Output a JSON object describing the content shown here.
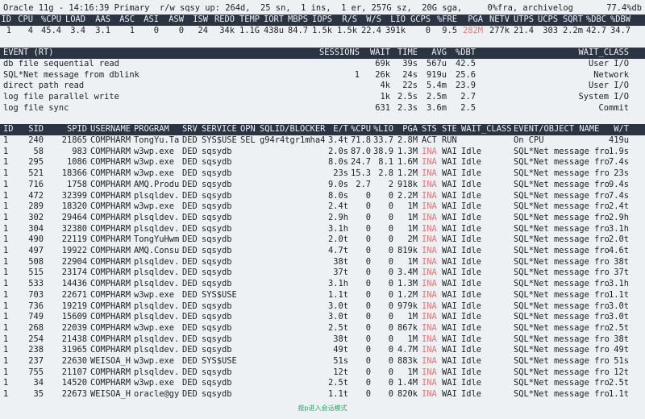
{
  "summary": {
    "title_line_left": "Oracle 11g - 14:16:39 Primary  r/w sqsy up: 264d,  25 sn,  1 ins,  1 er, 257G sz,  20G sga,     0%fra, archivelog",
    "title_line_right": "77.4%db"
  },
  "metrics": {
    "headers": [
      "ID",
      "CPU",
      "%CPU",
      "LOAD",
      "AAS",
      "ASC",
      "ASI",
      "ASW",
      "ISW",
      "REDO",
      "TEMP",
      "IORT",
      "MBPS",
      "IOPS",
      "R/S",
      "W/S",
      "LIO",
      "GCPS",
      "%FRE",
      "PGA",
      "NETV",
      "UTPS",
      "UCPS",
      "SQRT",
      "%DBC",
      "%DBW"
    ],
    "values": [
      "1",
      "4",
      "45.4",
      "3.4",
      "3.1",
      "1",
      "0",
      "0",
      "24",
      "34k",
      "1.1G",
      "438u",
      "84.7",
      "1.5k",
      "1.5k",
      "22.4",
      "391k",
      "0",
      "9.5",
      "282M",
      "277k",
      "21.4",
      "303",
      "2.2m",
      "42.7",
      "34.7"
    ]
  },
  "events": {
    "headers": [
      "EVENT (RT)",
      "SESSIONS",
      "WAIT",
      "TIME",
      "AVG",
      "%DBT",
      "WAIT_CLASS"
    ],
    "rows": [
      [
        "db file sequential read",
        "",
        "69k",
        "39s",
        "567u",
        "42.5",
        "User I/O"
      ],
      [
        "SQL*Net message from dblink",
        "1",
        "26k",
        "24s",
        "919u",
        "25.6",
        "Network"
      ],
      [
        "direct path read",
        "",
        "4k",
        "22s",
        "5.4m",
        "23.9",
        "User I/O"
      ],
      [
        "log file parallel write",
        "",
        "1k",
        "2.5s",
        "2.5m",
        "2.7",
        "System I/O"
      ],
      [
        "log file sync",
        "",
        "631",
        "2.3s",
        "3.6m",
        "2.5",
        "Commit"
      ]
    ]
  },
  "sessions": {
    "headers": [
      "ID",
      "SID",
      "SPID",
      "USERNAME",
      "PROGRAM",
      "SRV",
      "SERVICE",
      "OPN",
      "SQLID/BLOCKER",
      "E/T",
      "%CPU",
      "%LIO",
      "PGA",
      "STS",
      "STE",
      "WAIT_CLASS",
      "EVENT/OBJECT NAME",
      "W/T"
    ],
    "rows": [
      [
        "1",
        "240",
        "21865",
        "COMPHARM",
        "TongYu.Ta",
        "DED",
        "SYS$USE",
        "SEL",
        "g94r4tgr1mha4",
        "3.4t",
        "71.8",
        "33.7",
        "2.8M",
        "ACT",
        "RUN",
        "",
        "On CPU",
        "419u"
      ],
      [
        "1",
        "58",
        "983",
        "COMPHARM",
        "w3wp.exe",
        "DED",
        "sqsydb",
        "",
        "",
        "2.0s",
        "87.0",
        "38.9",
        "1.3M",
        "INA",
        "WAI",
        "Idle",
        "SQL*Net message fro",
        "1.9s"
      ],
      [
        "1",
        "295",
        "1086",
        "COMPHARM",
        "w3wp.exe",
        "DED",
        "sqsydb",
        "",
        "",
        "8.0s",
        "24.7",
        "8.1",
        "1.6M",
        "INA",
        "WAI",
        "Idle",
        "SQL*Net message fro",
        "7.4s"
      ],
      [
        "1",
        "521",
        "18366",
        "COMPHARM",
        "w3wp.exe",
        "DED",
        "sqsydb",
        "",
        "",
        "23s",
        "15.3",
        "2.8",
        "1.2M",
        "INA",
        "WAI",
        "Idle",
        "SQL*Net message fro",
        "23s"
      ],
      [
        "1",
        "716",
        "1758",
        "COMPHARM",
        "AMQ.Produ",
        "DED",
        "sqsydb",
        "",
        "",
        "9.0s",
        "2.7",
        "2",
        "918k",
        "INA",
        "WAI",
        "Idle",
        "SQL*Net message fro",
        "9.4s"
      ],
      [
        "1",
        "472",
        "32399",
        "COMPHARM",
        "plsqldev.",
        "DED",
        "sqsydb",
        "",
        "",
        "8.0s",
        "0",
        "0",
        "2.2M",
        "INA",
        "WAI",
        "Idle",
        "SQL*Net message fro",
        "7.4s"
      ],
      [
        "1",
        "289",
        "18320",
        "COMPHARM",
        "w3wp.exe",
        "DED",
        "sqsydb",
        "",
        "",
        "2.4t",
        "0",
        "0",
        "1M",
        "INA",
        "WAI",
        "Idle",
        "SQL*Net message fro",
        "2.4t"
      ],
      [
        "1",
        "302",
        "29464",
        "COMPHARM",
        "plsqldev.",
        "DED",
        "sqsydb",
        "",
        "",
        "2.9h",
        "0",
        "0",
        "1M",
        "INA",
        "WAI",
        "Idle",
        "SQL*Net message fro",
        "2.9h"
      ],
      [
        "1",
        "304",
        "32380",
        "COMPHARM",
        "plsqldev.",
        "DED",
        "sqsydb",
        "",
        "",
        "3.1h",
        "0",
        "0",
        "1M",
        "INA",
        "WAI",
        "Idle",
        "SQL*Net message fro",
        "3.1h"
      ],
      [
        "1",
        "490",
        "22119",
        "COMPHARM",
        "TongYuHwm",
        "DED",
        "sqsydb",
        "",
        "",
        "2.0t",
        "0",
        "0",
        "2M",
        "INA",
        "WAI",
        "Idle",
        "SQL*Net message fro",
        "2.0t"
      ],
      [
        "1",
        "497",
        "19922",
        "COMPHARM",
        "AMQ.Consu",
        "DED",
        "sqsydb",
        "",
        "",
        "4.7t",
        "0",
        "0",
        "819k",
        "INA",
        "WAI",
        "Idle",
        "SQL*Net message fro",
        "4.6t"
      ],
      [
        "1",
        "508",
        "22904",
        "COMPHARM",
        "plsqldev.",
        "DED",
        "sqsydb",
        "",
        "",
        "38t",
        "0",
        "0",
        "1M",
        "INA",
        "WAI",
        "Idle",
        "SQL*Net message fro",
        "38t"
      ],
      [
        "1",
        "515",
        "23174",
        "COMPHARM",
        "plsqldev.",
        "DED",
        "sqsydb",
        "",
        "",
        "37t",
        "0",
        "0",
        "3.4M",
        "INA",
        "WAI",
        "Idle",
        "SQL*Net message fro",
        "37t"
      ],
      [
        "1",
        "533",
        "14436",
        "COMPHARM",
        "plsqldev.",
        "DED",
        "sqsydb",
        "",
        "",
        "3.1h",
        "0",
        "0",
        "1.3M",
        "INA",
        "WAI",
        "Idle",
        "SQL*Net message fro",
        "3.1h"
      ],
      [
        "1",
        "703",
        "22671",
        "COMPHARM",
        "w3wp.exe",
        "DED",
        "SYS$USE",
        "",
        "",
        "1.1t",
        "0",
        "0",
        "1.2M",
        "INA",
        "WAI",
        "Idle",
        "SQL*Net message fro",
        "1.1t"
      ],
      [
        "1",
        "736",
        "19219",
        "COMPHARM",
        "plsqldev.",
        "DED",
        "sqsydb",
        "",
        "",
        "3.0t",
        "0",
        "0",
        "979k",
        "INA",
        "WAI",
        "Idle",
        "SQL*Net message fro",
        "3.0t"
      ],
      [
        "1",
        "749",
        "15609",
        "COMPHARM",
        "plsqldev.",
        "DED",
        "sqsydb",
        "",
        "",
        "3.0t",
        "0",
        "0",
        "1M",
        "INA",
        "WAI",
        "Idle",
        "SQL*Net message fro",
        "3.0t"
      ],
      [
        "1",
        "268",
        "22039",
        "COMPHARM",
        "w3wp.exe",
        "DED",
        "sqsydb",
        "",
        "",
        "2.5t",
        "0",
        "0",
        "867k",
        "INA",
        "WAI",
        "Idle",
        "SQL*Net message fro",
        "2.5t"
      ],
      [
        "1",
        "254",
        "21438",
        "COMPHARM",
        "plsqldev.",
        "DED",
        "sqsydb",
        "",
        "",
        "38t",
        "0",
        "0",
        "1M",
        "INA",
        "WAI",
        "Idle",
        "SQL*Net message fro",
        "38t"
      ],
      [
        "1",
        "238",
        "31965",
        "COMPHARM",
        "plsqldev.",
        "DED",
        "sqsydb",
        "",
        "",
        "49t",
        "0",
        "0",
        "4.7M",
        "INA",
        "WAI",
        "Idle",
        "SQL*Net message fro",
        "49t"
      ],
      [
        "1",
        "237",
        "22630",
        "WEISOA_H",
        "w3wp.exe",
        "DED",
        "SYS$USE",
        "",
        "",
        "51s",
        "0",
        "0",
        "883k",
        "INA",
        "WAI",
        "Idle",
        "SQL*Net message fro",
        "51s"
      ],
      [
        "1",
        "755",
        "21107",
        "COMPHARM",
        "plsqldev.",
        "DED",
        "sqsydb",
        "",
        "",
        "12t",
        "0",
        "0",
        "1M",
        "INA",
        "WAI",
        "Idle",
        "SQL*Net message fro",
        "12t"
      ],
      [
        "1",
        "34",
        "14520",
        "COMPHARM",
        "w3wp.exe",
        "DED",
        "sqsydb",
        "",
        "",
        "2.5t",
        "0",
        "0",
        "1.4M",
        "INA",
        "WAI",
        "Idle",
        "SQL*Net message fro",
        "2.5t"
      ],
      [
        "1",
        "35",
        "22673",
        "WEISOA_H",
        "oracle@gy",
        "DED",
        "sqsydb",
        "",
        "",
        "1.1t",
        "0",
        "0",
        "820k",
        "INA",
        "WAI",
        "Idle",
        "SQL*Net message fro",
        "1.1t"
      ]
    ]
  },
  "footer": {
    "hint": "按p进入会话模式"
  },
  "colors": {
    "header_bg": "#2a3442",
    "highlight_red": "#e07a7a",
    "hint_green": "#2aa86a"
  }
}
